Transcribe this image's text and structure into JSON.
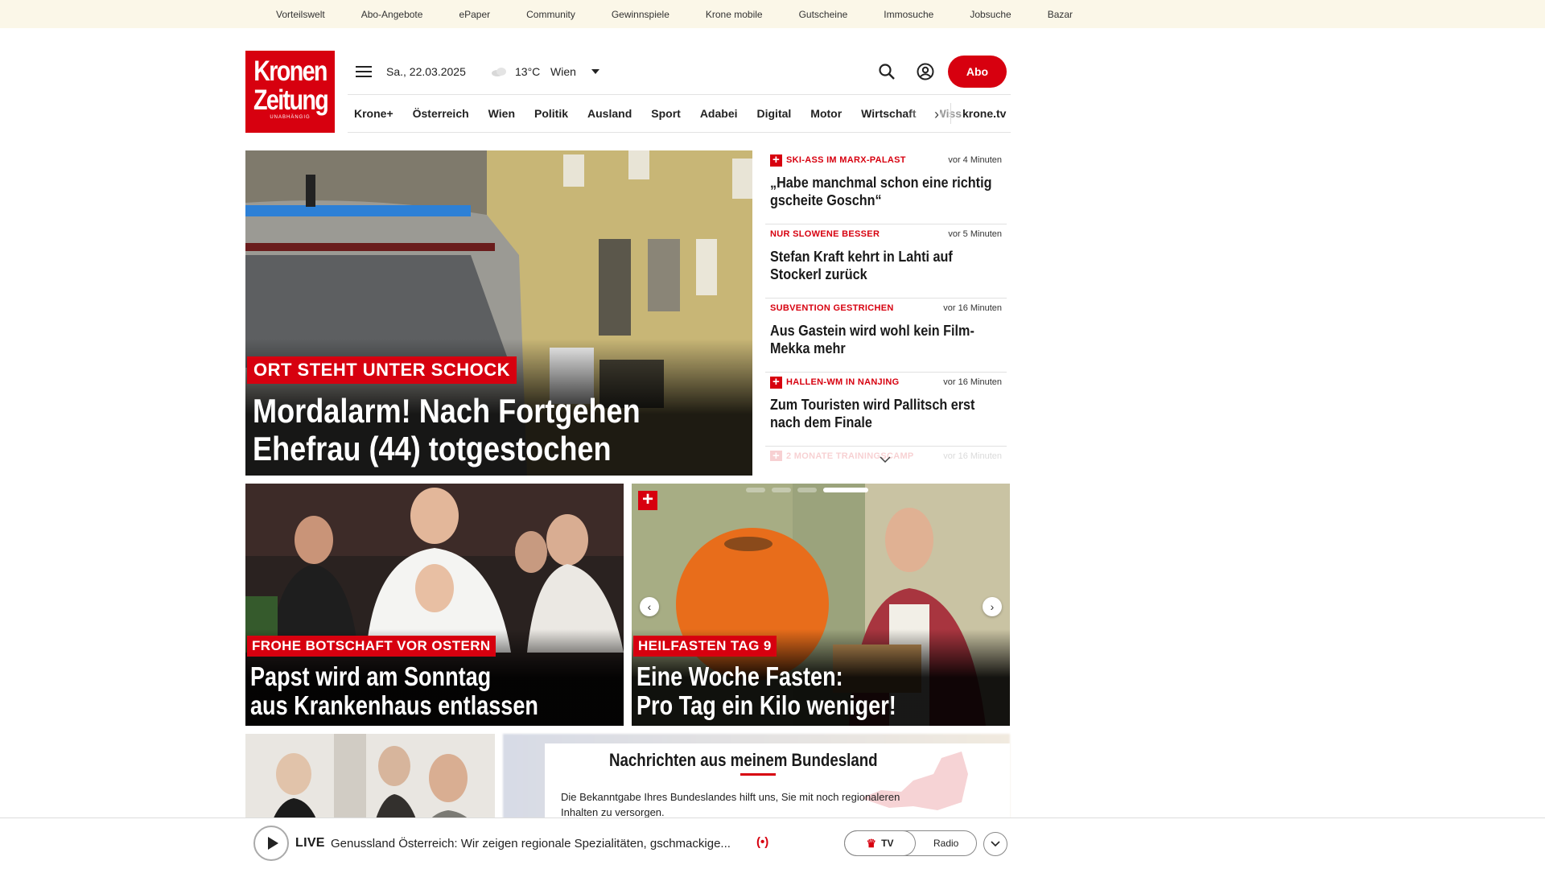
{
  "topbar": {
    "links": [
      "Vorteilswelt",
      "Abo-Angebote",
      "ePaper",
      "Community",
      "Gewinnspiele",
      "Krone mobile",
      "Gutscheine",
      "Immosuche",
      "Jobsuche",
      "Bazar"
    ]
  },
  "logo": {
    "line1": "Kronen",
    "line2": "Zeitung",
    "tagline": "UNABHÄNGIG"
  },
  "header": {
    "date": "Sa., 22.03.2025",
    "temperature": "13°C",
    "city": "Wien",
    "abo_label": "Abo"
  },
  "nav": {
    "items": [
      "Krone+",
      "Österreich",
      "Wien",
      "Politik",
      "Ausland",
      "Sport",
      "Adabei",
      "Digital",
      "Motor",
      "Wirtschaft",
      "Wiss"
    ],
    "tv_label": "krone.tv"
  },
  "hero": {
    "kicker": "ORT STEHT UNTER SCHOCK",
    "headline_line1": "Mordalarm! Nach Fortgehen",
    "headline_line2": "Ehefrau (44) totgestochen"
  },
  "ticker": [
    {
      "plus": true,
      "kicker": "SKI-ASS IM MARX-PALAST",
      "time": "vor 4 Minuten",
      "title": "„Habe manchmal schon eine richtig gscheite Goschn“"
    },
    {
      "plus": false,
      "kicker": "NUR SLOWENE BESSER",
      "time": "vor 5 Minuten",
      "title": "Stefan Kraft kehrt in Lahti auf Stockerl zurück"
    },
    {
      "plus": false,
      "kicker": "SUBVENTION GESTRICHEN",
      "time": "vor 16 Minuten",
      "title": "Aus Gastein wird wohl kein Film-Mekka mehr"
    },
    {
      "plus": true,
      "kicker": "HALLEN-WM IN NANJING",
      "time": "vor 16 Minuten",
      "title": "Zum Touristen wird Pallitsch erst nach dem Finale"
    },
    {
      "plus": true,
      "kicker": "2 MONATE TRAININGSCAMP",
      "time": "vor 16 Minuten",
      "title": ""
    }
  ],
  "cards": [
    {
      "kicker": "FROHE BOTSCHAFT VOR OSTERN",
      "line1": "Papst wird am Sonntag",
      "line2": "aus Krankenhaus entlassen"
    },
    {
      "kicker": "HEILFASTEN TAG 9",
      "line1": "Eine Woche Fasten:",
      "line2": "Pro Tag ein Kilo weniger!"
    }
  ],
  "carousel": {
    "slide_count": 4,
    "active_index": 3
  },
  "region": {
    "title": "Nachrichten aus meinem Bundesland",
    "text": "Die Bekanntgabe Ihres Bundeslandes hilft uns, Sie mit noch regionaleren Inhalten zu versorgen."
  },
  "player": {
    "live_label": "LIVE",
    "now_playing": "Genussland Österreich: Wir zeigen regionale Spezialitäten, gschmackige...",
    "tv_label": "TV",
    "radio_label": "Radio"
  },
  "colors": {
    "brand": "#d7000f",
    "topbar_bg": "#fbf7e8"
  }
}
